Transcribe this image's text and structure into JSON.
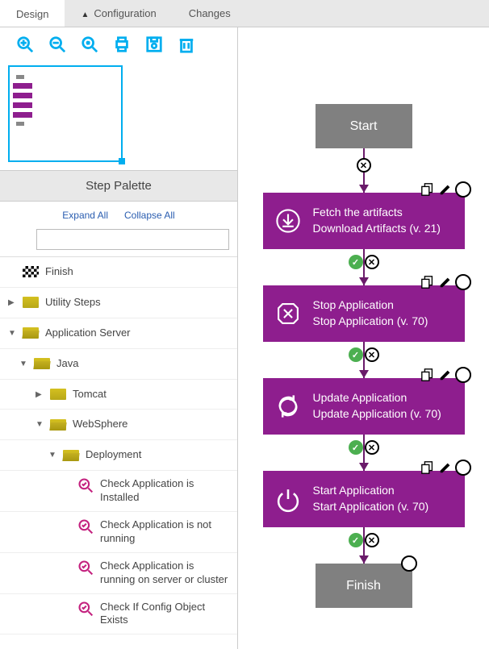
{
  "tabs": {
    "design": "Design",
    "configuration": "Configuration",
    "changes": "Changes"
  },
  "palette": {
    "title": "Step Palette",
    "expand_all": "Expand All",
    "collapse_all": "Collapse All",
    "search_placeholder": ""
  },
  "tree": {
    "finish": "Finish",
    "utility_steps": "Utility Steps",
    "application_server": "Application Server",
    "java": "Java",
    "tomcat": "Tomcat",
    "websphere": "WebSphere",
    "deployment": "Deployment",
    "check_installed": "Check Application is Installed",
    "check_not_running": "Check Application is not running",
    "check_running": "Check Application is running on server or cluster",
    "check_config": "Check If Config Object Exists"
  },
  "flow": {
    "start": "Start",
    "finish": "Finish",
    "steps": [
      {
        "title": "Fetch the artifacts",
        "subtitle": "Download Artifacts (v. 21)"
      },
      {
        "title": "Stop Application",
        "subtitle": "Stop Application (v. 70)"
      },
      {
        "title": "Update Application",
        "subtitle": "Update Application (v. 70)"
      },
      {
        "title": "Start Application",
        "subtitle": "Start Application (v. 70)"
      }
    ]
  },
  "colors": {
    "accent": "#00aeef",
    "purple": "#8e1e8e",
    "gray": "#808080"
  }
}
